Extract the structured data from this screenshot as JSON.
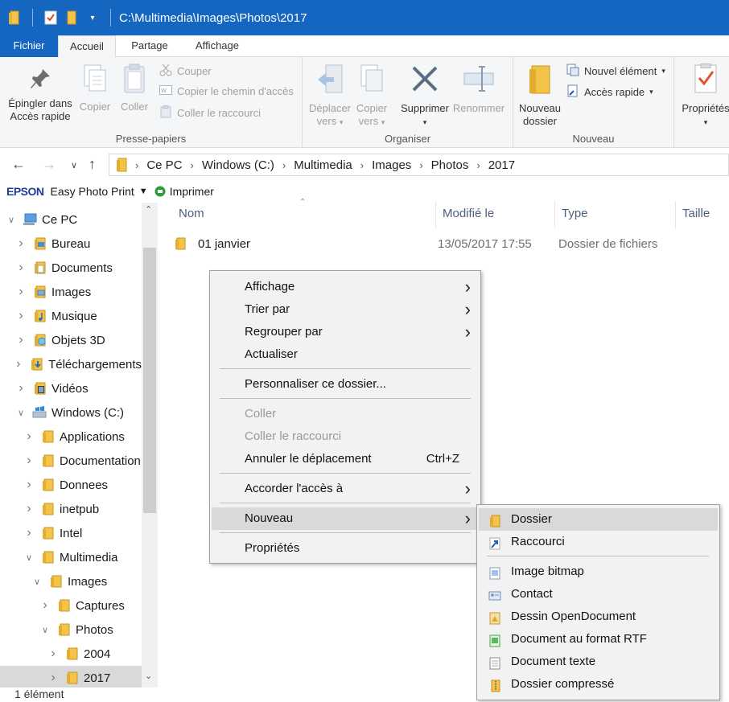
{
  "window": {
    "title": "C:\\Multimedia\\Images\\Photos\\2017"
  },
  "ribbon_tabs": [
    "Fichier",
    "Accueil",
    "Partage",
    "Affichage"
  ],
  "ribbon": {
    "clipboard": {
      "pin_line1": "Épingler dans",
      "pin_line2": "Accès rapide",
      "copy": "Copier",
      "paste": "Coller",
      "cut": "Couper",
      "copy_path": "Copier le chemin d'accès",
      "paste_shortcut": "Coller le raccourci",
      "label": "Presse-papiers"
    },
    "organize": {
      "move_line1": "Déplacer",
      "move_line2": "vers",
      "copyto_line1": "Copier",
      "copyto_line2": "vers",
      "delete": "Supprimer",
      "rename": "Renommer",
      "label": "Organiser"
    },
    "new": {
      "folder_line1": "Nouveau",
      "folder_line2": "dossier",
      "new_item": "Nouvel élément",
      "quick_access": "Accès rapide",
      "label": "Nouveau"
    },
    "open": {
      "properties": "Propriétés"
    }
  },
  "breadcrumb": [
    "Ce PC",
    "Windows (C:)",
    "Multimedia",
    "Images",
    "Photos",
    "2017"
  ],
  "epson_bar": {
    "brand": "EPSON",
    "app": "Easy Photo Print",
    "print": "Imprimer"
  },
  "sidebar": {
    "items": [
      {
        "label": "Ce PC",
        "indent": 0,
        "expanded": true,
        "icon": "computer-icon"
      },
      {
        "label": "Bureau",
        "indent": 1,
        "icon": "desktop-folder-icon"
      },
      {
        "label": "Documents",
        "indent": 1,
        "icon": "documents-folder-icon"
      },
      {
        "label": "Images",
        "indent": 1,
        "icon": "pictures-folder-icon"
      },
      {
        "label": "Musique",
        "indent": 1,
        "icon": "music-folder-icon"
      },
      {
        "label": "Objets 3D",
        "indent": 1,
        "icon": "3d-objects-folder-icon"
      },
      {
        "label": "Téléchargements",
        "indent": 1,
        "icon": "downloads-folder-icon"
      },
      {
        "label": "Vidéos",
        "indent": 1,
        "icon": "videos-folder-icon"
      },
      {
        "label": "Windows (C:)",
        "indent": 1,
        "expanded": true,
        "icon": "drive-icon"
      },
      {
        "label": "Applications",
        "indent": 2,
        "icon": "folder-icon"
      },
      {
        "label": "Documentation",
        "indent": 2,
        "icon": "folder-icon"
      },
      {
        "label": "Donnees",
        "indent": 2,
        "icon": "folder-icon"
      },
      {
        "label": "inetpub",
        "indent": 2,
        "icon": "folder-icon"
      },
      {
        "label": "Intel",
        "indent": 2,
        "icon": "folder-icon"
      },
      {
        "label": "Multimedia",
        "indent": 2,
        "expanded": true,
        "icon": "folder-icon"
      },
      {
        "label": "Images",
        "indent": 3,
        "expanded": true,
        "icon": "folder-icon"
      },
      {
        "label": "Captures",
        "indent": 4,
        "icon": "folder-icon"
      },
      {
        "label": "Photos",
        "indent": 4,
        "expanded": true,
        "icon": "folder-icon"
      },
      {
        "label": "2004",
        "indent": 5,
        "icon": "folder-icon"
      },
      {
        "label": "2017",
        "indent": 5,
        "selected": true,
        "icon": "folder-icon"
      }
    ]
  },
  "columns": [
    "Nom",
    "Modifié le",
    "Type",
    "Taille"
  ],
  "files": [
    {
      "name": "01 janvier",
      "modified": "13/05/2017 17:55",
      "type": "Dossier de fichiers",
      "size": ""
    }
  ],
  "status": "1 élément",
  "context_menu": {
    "items": [
      {
        "label": "Affichage",
        "submenu": true
      },
      {
        "label": "Trier par",
        "submenu": true
      },
      {
        "label": "Regrouper par",
        "submenu": true
      },
      {
        "label": "Actualiser"
      },
      {
        "separator": true
      },
      {
        "label": "Personnaliser ce dossier..."
      },
      {
        "separator": true
      },
      {
        "label": "Coller",
        "disabled": true
      },
      {
        "label": "Coller le raccourci",
        "disabled": true
      },
      {
        "label": "Annuler le déplacement",
        "accel": "Ctrl+Z"
      },
      {
        "separator": true
      },
      {
        "label": "Accorder l'accès à",
        "submenu": true
      },
      {
        "separator": true
      },
      {
        "label": "Nouveau",
        "submenu": true,
        "highlighted": true
      },
      {
        "separator": true
      },
      {
        "label": "Propriétés"
      }
    ]
  },
  "submenu_new": {
    "items": [
      {
        "label": "Dossier",
        "icon": "folder-icon",
        "highlighted": true
      },
      {
        "label": "Raccourci",
        "icon": "shortcut-icon"
      },
      {
        "separator": true
      },
      {
        "label": "Image bitmap",
        "icon": "bitmap-icon"
      },
      {
        "label": "Contact",
        "icon": "contact-icon"
      },
      {
        "label": "Dessin OpenDocument",
        "icon": "odg-drawing-icon"
      },
      {
        "label": "Document au format RTF",
        "icon": "rtf-document-icon"
      },
      {
        "label": "Document texte",
        "icon": "text-document-icon"
      },
      {
        "label": "Dossier compressé",
        "icon": "zip-folder-icon"
      }
    ]
  },
  "colors": {
    "titlebar": "#1566c0",
    "ribbon_bg": "#f5f6f7",
    "folder": "#f3c34a",
    "highlight": "#d9d9d9"
  }
}
